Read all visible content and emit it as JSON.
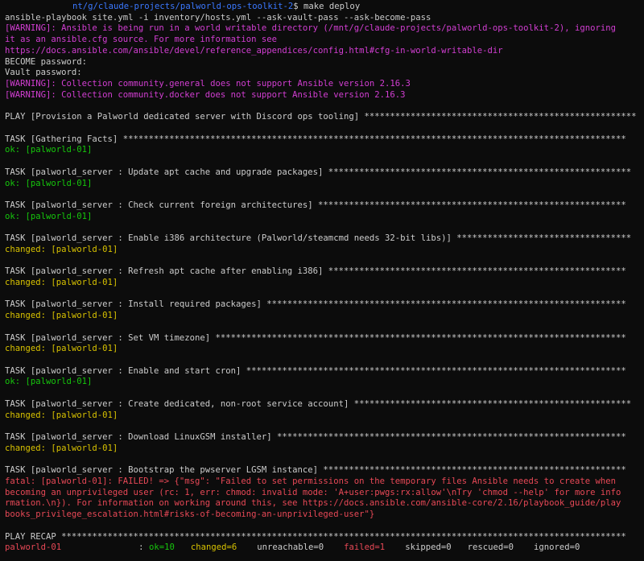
{
  "prompt": {
    "path": "nt/g/claude-projects/palworld-ops-toolkit-2",
    "symbol": "$",
    "command": " make deploy"
  },
  "lines": [
    {
      "text": "ansible-playbook site.yml -i inventory/hosts.yml --ask-vault-pass --ask-become-pass",
      "color": "white"
    },
    {
      "text": "[WARNING]: Ansible is being run in a world writable directory (/mnt/g/claude-projects/palworld-ops-toolkit-2), ignoring",
      "color": "magenta"
    },
    {
      "text": "it as an ansible.cfg source. For more information see",
      "color": "magenta"
    },
    {
      "text": "https://docs.ansible.com/ansible/devel/reference_appendices/config.html#cfg-in-world-writable-dir",
      "color": "magenta"
    },
    {
      "text": "BECOME password:",
      "color": "white"
    },
    {
      "text": "Vault password:",
      "color": "white"
    },
    {
      "text": "[WARNING]: Collection community.general does not support Ansible version 2.16.3",
      "color": "magenta"
    },
    {
      "text": "[WARNING]: Collection community.docker does not support Ansible version 2.16.3",
      "color": "magenta"
    },
    {
      "text": "",
      "color": "white"
    },
    {
      "text": "PLAY [Provision a Palworld dedicated server with Discord ops tooling] *****************************************************",
      "color": "white"
    },
    {
      "text": "",
      "color": "white"
    },
    {
      "text": "TASK [Gathering Facts] **************************************************************************************************",
      "color": "white"
    },
    {
      "text": "ok: [palworld-01]",
      "color": "green"
    },
    {
      "text": "",
      "color": "white"
    },
    {
      "text": "TASK [palworld_server : Update apt cache and upgrade packages] ***********************************************************",
      "color": "white"
    },
    {
      "text": "ok: [palworld-01]",
      "color": "green"
    },
    {
      "text": "",
      "color": "white"
    },
    {
      "text": "TASK [palworld_server : Check current foreign architectures] ************************************************************",
      "color": "white"
    },
    {
      "text": "ok: [palworld-01]",
      "color": "green"
    },
    {
      "text": "",
      "color": "white"
    },
    {
      "text": "TASK [palworld_server : Enable i386 architecture (Palworld/steamcmd needs 32-bit libs)] **********************************",
      "color": "white"
    },
    {
      "text": "changed: [palworld-01]",
      "color": "yellow"
    },
    {
      "text": "",
      "color": "white"
    },
    {
      "text": "TASK [palworld_server : Refresh apt cache after enabling i386] **********************************************************",
      "color": "white"
    },
    {
      "text": "changed: [palworld-01]",
      "color": "yellow"
    },
    {
      "text": "",
      "color": "white"
    },
    {
      "text": "TASK [palworld_server : Install required packages] **********************************************************************",
      "color": "white"
    },
    {
      "text": "changed: [palworld-01]",
      "color": "yellow"
    },
    {
      "text": "",
      "color": "white"
    },
    {
      "text": "TASK [palworld_server : Set VM timezone] ********************************************************************************",
      "color": "white"
    },
    {
      "text": "changed: [palworld-01]",
      "color": "yellow"
    },
    {
      "text": "",
      "color": "white"
    },
    {
      "text": "TASK [palworld_server : Enable and start cron] **************************************************************************",
      "color": "white"
    },
    {
      "text": "ok: [palworld-01]",
      "color": "green"
    },
    {
      "text": "",
      "color": "white"
    },
    {
      "text": "TASK [palworld_server : Create dedicated, non-root service account] ******************************************************",
      "color": "white"
    },
    {
      "text": "changed: [palworld-01]",
      "color": "yellow"
    },
    {
      "text": "",
      "color": "white"
    },
    {
      "text": "TASK [palworld_server : Download LinuxGSM installer] ********************************************************************",
      "color": "white"
    },
    {
      "text": "changed: [palworld-01]",
      "color": "yellow"
    },
    {
      "text": "",
      "color": "white"
    },
    {
      "text": "TASK [palworld_server : Bootstrap the pwserver LGSM instance] ***********************************************************",
      "color": "white"
    },
    {
      "text": "fatal: [palworld-01]: FAILED! => {\"msg\": \"Failed to set permissions on the temporary files Ansible needs to create when",
      "color": "red"
    },
    {
      "text": "becoming an unprivileged user (rc: 1, err: chmod: invalid mode: 'A+user:pwgs:rx:allow'\\nTry 'chmod --help' for more info",
      "color": "red"
    },
    {
      "text": "rmation.\\n}). For information on working around this, see https://docs.ansible.com/ansible-core/2.16/playbook_guide/play",
      "color": "red"
    },
    {
      "text": "books_privilege_escalation.html#risks-of-becoming-an-unprivileged-user\"}",
      "color": "red"
    },
    {
      "text": "",
      "color": "white"
    },
    {
      "text": "PLAY RECAP **************************************************************************************************************",
      "color": "white"
    }
  ],
  "recap": {
    "host": "palworld-01",
    "sep": ": ",
    "ok": "ok=10",
    "changed": "changed=6",
    "unreachable": "unreachable=0",
    "failed": "failed=1",
    "skipped": "skipped=0",
    "rescued": "rescued=0",
    "ignored": "ignored=0"
  },
  "colors": {
    "background": "#0c0c0c",
    "white": "#cccccc",
    "blue": "#3b78ff",
    "magenta": "#d23ed2",
    "green": "#16c60c",
    "yellow": "#d8c200",
    "red": "#e74856"
  }
}
